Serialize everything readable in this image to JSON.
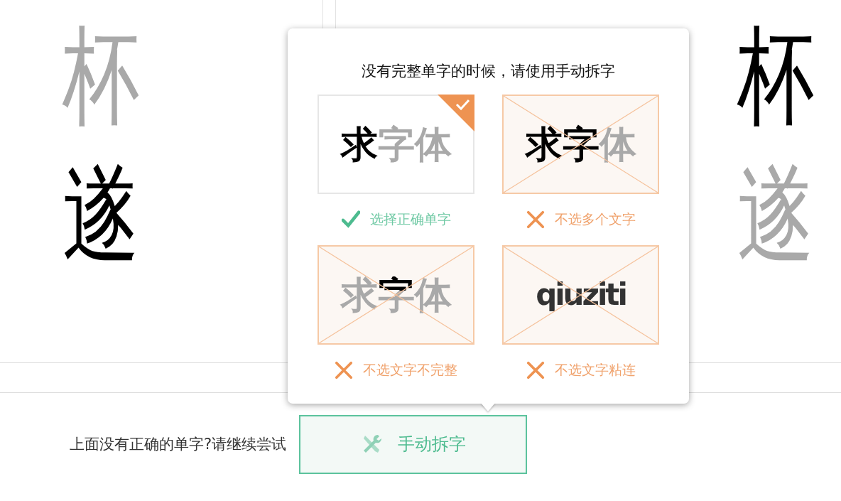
{
  "left_panel": {
    "rows": [
      {
        "glyphs": [
          {
            "text": "杯",
            "faded": true
          }
        ]
      },
      {
        "glyphs": [
          {
            "text": "遂",
            "faded": false
          }
        ]
      }
    ]
  },
  "right_panel": {
    "rows": [
      {
        "glyphs": [
          {
            "text": "杯",
            "faded": false
          }
        ]
      },
      {
        "glyphs": [
          {
            "text": "遂",
            "faded": true
          }
        ]
      }
    ]
  },
  "popup": {
    "title": "没有完整单字的时候，请使用手动拆字",
    "cards": [
      {
        "kind": "correct",
        "sample": [
          {
            "text": "求",
            "faded": false,
            "partial": false
          },
          {
            "text": "字",
            "faded": true,
            "partial": false
          },
          {
            "text": "体",
            "faded": true,
            "partial": false
          }
        ],
        "caption": "选择正确单字"
      },
      {
        "kind": "wrong",
        "sample": [
          {
            "text": "求",
            "faded": false,
            "partial": false
          },
          {
            "text": "字",
            "faded": false,
            "partial": false
          },
          {
            "text": "体",
            "faded": true,
            "partial": false
          }
        ],
        "caption": "不选多个文字"
      },
      {
        "kind": "wrong",
        "sample": [
          {
            "text": "求",
            "faded": true,
            "partial": false
          },
          {
            "text": "字",
            "faded": true,
            "partial": true
          },
          {
            "text": "体",
            "faded": true,
            "partial": false
          }
        ],
        "caption": "不选文字不完整"
      },
      {
        "kind": "wrong_latin",
        "sample": [
          {
            "text": "qiuziti",
            "faded": false,
            "partial": false
          }
        ],
        "caption": "不选文字粘连"
      }
    ]
  },
  "prompt": "上面没有正确的单字?请继续尝试",
  "manual_button": {
    "label": "手动拆字"
  }
}
